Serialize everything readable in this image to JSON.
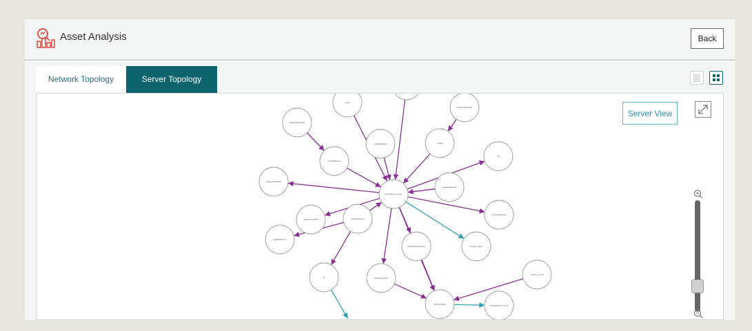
{
  "header": {
    "title": "Asset Analysis",
    "back_label": "Back",
    "icon": "asset-analysis-icon"
  },
  "tabs": [
    {
      "label": "Network Topology",
      "active": false
    },
    {
      "label": "Server Topology",
      "active": true
    }
  ],
  "view_toggles": [
    {
      "icon": "list-view-icon",
      "active": false
    },
    {
      "icon": "grid-view-icon",
      "active": true
    }
  ],
  "canvas": {
    "server_view_label": "Server View",
    "zoom_level": 0.12
  },
  "colors": {
    "active_tab": "#0e646c",
    "edge_purple": "#8a2d95",
    "edge_teal": "#2b9eb0",
    "accent_icon": "#e2453b"
  },
  "graph": {
    "nodes": [
      {
        "id": "n_dns",
        "label": "nginx"
      },
      {
        "id": "n_top",
        "label": ""
      },
      {
        "id": "n_kube",
        "label": "kuaimodulev111"
      },
      {
        "id": "n_hadoop",
        "label": "hadoopdatanode"
      },
      {
        "id": "n_redis",
        "label": "redisdatabase"
      },
      {
        "id": "n_nodejs",
        "label": "nodejs"
      },
      {
        "id": "n_win2016",
        "label": "win2016server"
      },
      {
        "id": "n_ssl",
        "label": "ssl"
      },
      {
        "id": "n_sql2008",
        "label": "SQLserver2008"
      },
      {
        "id": "n_center",
        "label": "prometheus_server"
      },
      {
        "id": "n_postgres",
        "label": "postgresqlserver"
      },
      {
        "id": "n_mongo",
        "label": "mongodbserver"
      },
      {
        "id": "n_sqlserver",
        "label": "SQLserver2012"
      },
      {
        "id": "n_win2012",
        "label": "win2012server"
      },
      {
        "id": "n_logstash",
        "label": "logstashserver"
      },
      {
        "id": "n_elastic",
        "label": "elasticsearchserver"
      },
      {
        "id": "n_mongo2",
        "label": "mongo_server"
      },
      {
        "id": "n_iis",
        "label": "iis"
      },
      {
        "id": "n_grafana",
        "label": "grafana_server"
      },
      {
        "id": "n_monitor",
        "label": "monitor_server"
      },
      {
        "id": "n_alert",
        "label": "alertmanager"
      },
      {
        "id": "n_push",
        "label": "pushgateway_server"
      }
    ],
    "edges": [
      {
        "from": "n_dns",
        "to": "n_center",
        "kind": "purple"
      },
      {
        "from": "n_top",
        "to": "n_center",
        "kind": "purple"
      },
      {
        "from": "n_kube",
        "to": "n_nodejs",
        "kind": "purple"
      },
      {
        "from": "n_redis",
        "to": "n_center",
        "kind": "purple"
      },
      {
        "from": "n_nodejs",
        "to": "n_center",
        "kind": "purple"
      },
      {
        "from": "n_hadoop",
        "to": "n_win2016",
        "kind": "purple"
      },
      {
        "from": "n_win2016",
        "to": "n_center",
        "kind": "purple"
      },
      {
        "from": "n_center",
        "to": "n_ssl",
        "kind": "purple"
      },
      {
        "from": "n_center",
        "to": "n_sql2008",
        "kind": "purple"
      },
      {
        "from": "n_postgres",
        "to": "n_center",
        "kind": "purple"
      },
      {
        "from": "n_center",
        "to": "n_mongo",
        "kind": "purple"
      },
      {
        "from": "n_win2012",
        "to": "n_center",
        "kind": "purple"
      },
      {
        "from": "n_center",
        "to": "n_sqlserver",
        "kind": "purple"
      },
      {
        "from": "n_win2012",
        "to": "n_logstash",
        "kind": "purple"
      },
      {
        "from": "n_center",
        "to": "n_elastic",
        "kind": "purple"
      },
      {
        "from": "n_center",
        "to": "n_mongo2",
        "kind": "teal"
      },
      {
        "from": "n_win2012",
        "to": "n_iis",
        "kind": "purple"
      },
      {
        "from": "n_center",
        "to": "n_grafana",
        "kind": "purple"
      },
      {
        "from": "n_elastic",
        "to": "n_alert",
        "kind": "purple"
      },
      {
        "from": "n_grafana",
        "to": "n_alert",
        "kind": "purple"
      },
      {
        "from": "n_monitor",
        "to": "n_alert",
        "kind": "purple"
      },
      {
        "from": "n_alert",
        "to": "n_push",
        "kind": "teal"
      },
      {
        "from": "n_center",
        "to": "n_alert",
        "kind": "purple"
      },
      {
        "from": "n_iis",
        "to": "n_bottom",
        "kind": "teal"
      }
    ]
  }
}
